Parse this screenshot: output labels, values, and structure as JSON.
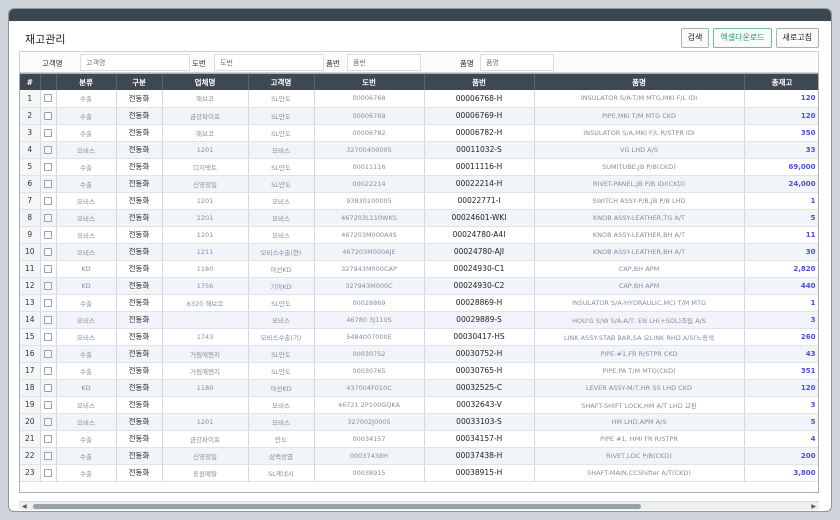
{
  "page": {
    "title": "재고관리"
  },
  "toolbar": {
    "search_label": "검색",
    "excel_label": "엑셀다운로드",
    "refresh_label": "새로고침"
  },
  "search": {
    "customer_label": "고객명",
    "customer_placeholder": "고객명",
    "drawing_label": "도번",
    "drawing_placeholder": "도번",
    "partno_label": "품번",
    "partno_placeholder": "품번",
    "partname_label": "품명",
    "partname_placeholder": "품명"
  },
  "grid": {
    "columns": [
      "#",
      "",
      "분류",
      "구분",
      "업체명",
      "고객명",
      "도번",
      "품번",
      "품명",
      "총재고"
    ],
    "rows": [
      {
        "no": "1",
        "cat": "수출",
        "div": "전동화",
        "vendor": "해브코",
        "cust": "SL만도",
        "drawing": "00006768",
        "part": "00006768-H",
        "name": "INSULATOR S/A-T/M MTG,MKI F/L IDI",
        "qty": "120"
      },
      {
        "no": "2",
        "cat": "수출",
        "div": "전동화",
        "vendor": "금강파이프",
        "cust": "SL만도",
        "drawing": "00006769",
        "part": "00006769-H",
        "name": "PIPE,MKI T/M MTG CKD",
        "qty": "120"
      },
      {
        "no": "3",
        "cat": "수출",
        "div": "전동화",
        "vendor": "해브코",
        "cust": "SL만도",
        "drawing": "00006782",
        "part": "00006782-H",
        "name": "INSULATOR S/A,MKI F/L R/STPR IDI",
        "qty": "350"
      },
      {
        "no": "4",
        "cat": "모비스",
        "div": "전동화",
        "vendor": "1201",
        "cust": "모비스",
        "drawing": "32700400005",
        "part": "00011032-S",
        "name": "VG LHD A/S",
        "qty": "33"
      },
      {
        "no": "5",
        "cat": "수출",
        "div": "전동화",
        "vendor": "디지택트",
        "cust": "SL만도",
        "drawing": "00011116",
        "part": "00011116-H",
        "name": "SUMITUBE,JB P/B(CKD)",
        "qty": "69,000"
      },
      {
        "no": "6",
        "cat": "수출",
        "div": "전동화",
        "vendor": "신영정밀",
        "cust": "SL만도",
        "drawing": "00022214",
        "part": "00022214-H",
        "name": "RIVET-PANEL,JB P/B IDI(CKD)",
        "qty": "24,000"
      },
      {
        "no": "7",
        "cat": "모비스",
        "div": "전동화",
        "vendor": "1201",
        "cust": "모비스",
        "drawing": "93830100005",
        "part": "00022771-I",
        "name": "SWITCH ASSY-P/B,JB P/B LHD",
        "qty": "1"
      },
      {
        "no": "8",
        "cat": "모비스",
        "div": "전동화",
        "vendor": "1201",
        "cust": "모비스",
        "drawing": "467203L110WKS",
        "part": "00024601-WKI",
        "name": "KNOB ASSY-LEATHER,TG A/T",
        "qty": "5"
      },
      {
        "no": "9",
        "cat": "모비스",
        "div": "전동화",
        "vendor": "1201",
        "cust": "모비스",
        "drawing": "467203M000A4S",
        "part": "00024780-A4I",
        "name": "KNOB ASSY-LEATHER,BH A/T",
        "qty": "11"
      },
      {
        "no": "10",
        "cat": "모비스",
        "div": "전동화",
        "vendor": "1211",
        "cust": "모비스수출(현)",
        "drawing": "467203M000AJE",
        "part": "00024780-AJI",
        "name": "KNOB ASSY-LEATHER,BH A/T",
        "qty": "30"
      },
      {
        "no": "11",
        "cat": "KD",
        "div": "전동화",
        "vendor": "1180",
        "cust": "야선KD",
        "drawing": "327943M000CAP",
        "part": "00024930-C1",
        "name": "CAP,BH APM",
        "qty": "2,820"
      },
      {
        "no": "12",
        "cat": "KD",
        "div": "전동화",
        "vendor": "1756",
        "cust": "기아KD",
        "drawing": "327943M000C",
        "part": "00024930-C2",
        "name": "CAP,BH APM",
        "qty": "440"
      },
      {
        "no": "13",
        "cat": "수출",
        "div": "전동화",
        "vendor": "6320 해브코",
        "cust": "SL만도",
        "drawing": "00028869",
        "part": "00028869-H",
        "name": "INSULATOR S/A-HYDRAULIC,MCI T/M MTG",
        "qty": "1"
      },
      {
        "no": "14",
        "cat": "모비스",
        "div": "전동화",
        "vendor": "",
        "cust": "모비스",
        "drawing": "46780 3J110S",
        "part": "00029889-S",
        "name": "HOU'G S/W S/A-A/T, EN LH(+SOL)조립 A/S",
        "qty": "3"
      },
      {
        "no": "15",
        "cat": "모비스",
        "div": "전동화",
        "vendor": "1743",
        "cust": "모비스수출(기)",
        "drawing": "5484007000E",
        "part": "00030417-HS",
        "name": "LINK ASSY-STAB BAR,SA 오LINK RHD A/S(노랑색",
        "qty": "260"
      },
      {
        "no": "16",
        "cat": "수출",
        "div": "전동화",
        "vendor": "거림에엔지",
        "cust": "SL만도",
        "drawing": "00030752",
        "part": "00030752-H",
        "name": "PIPE-#1,FR R/STPR CKD",
        "qty": "43"
      },
      {
        "no": "17",
        "cat": "수출",
        "div": "전동화",
        "vendor": "거림에엔지",
        "cust": "SL만도",
        "drawing": "00030765",
        "part": "00030765-H",
        "name": "PIPE,PA T/M MTG(CKD)",
        "qty": "351"
      },
      {
        "no": "18",
        "cat": "KD",
        "div": "전동화",
        "vendor": "1180",
        "cust": "야선KD",
        "drawing": "437004F010C",
        "part": "00032525-C",
        "name": "LEVER ASSY-M/T,HR SS LHD CKD",
        "qty": "120"
      },
      {
        "no": "19",
        "cat": "모비스",
        "div": "전동화",
        "vendor": "",
        "cust": "모비스",
        "drawing": "46721 2P100GQKA",
        "part": "00032643-V",
        "name": "SHAFT-SHIFT LOCK,HM A/T LHD 교환",
        "qty": "3"
      },
      {
        "no": "20",
        "cat": "모비스",
        "div": "전동화",
        "vendor": "1201",
        "cust": "모비스",
        "drawing": "327002J0005",
        "part": "00033103-S",
        "name": "HM LHD,APM A/S",
        "qty": "5"
      },
      {
        "no": "21",
        "cat": "수출",
        "div": "전동화",
        "vendor": "금강파이프",
        "cust": "만도",
        "drawing": "00034157",
        "part": "00034157-H",
        "name": "PIPE #1, HMI FR R/STPR",
        "qty": "4"
      },
      {
        "no": "22",
        "cat": "수출",
        "div": "전동화",
        "vendor": "신영정밀",
        "cust": "삼백성엽",
        "drawing": "00037438H",
        "part": "00037438-H",
        "name": "RIVET,LDC P/B(CKD)",
        "qty": "200"
      },
      {
        "no": "23",
        "cat": "수출",
        "div": "전동화",
        "vendor": "동원메탈",
        "cust": "SL케네시",
        "drawing": "00038915",
        "part": "00038915-H",
        "name": "SHAFT-MAIN,CCShifter A/T(CKD)",
        "qty": "3,800"
      }
    ]
  },
  "scrollbar": {
    "left_arrow": "◀",
    "right_arrow": "▶"
  }
}
